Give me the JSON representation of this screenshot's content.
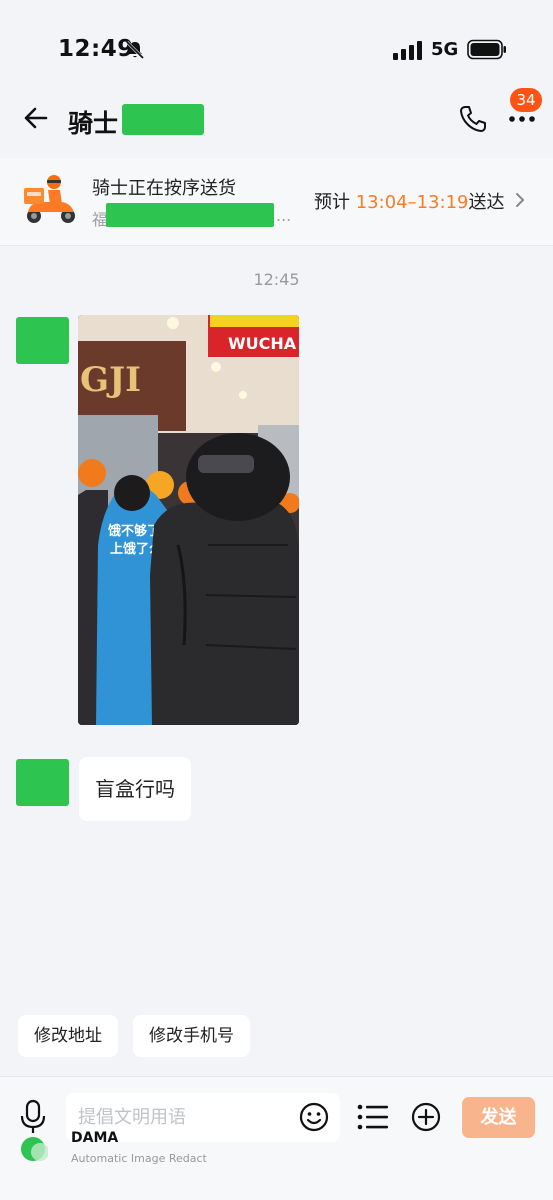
{
  "status_bar": {
    "time": "12:49",
    "network": "5G"
  },
  "header": {
    "title": "骑士",
    "unread_badge": "34"
  },
  "rider_card": {
    "status": "骑士正在按序送货",
    "address_prefix": "福",
    "address_ellipsis": "...",
    "eta_prefix": "预计",
    "eta_time": "13:04–13:19",
    "eta_suffix": "送达"
  },
  "chat": {
    "timestamp": "12:45",
    "photo_sign_text": "WUCHA",
    "photo_jacket_text_1": "饿不够了",
    "photo_jacket_text_2": "上饿了么",
    "message": "盲盒行吗"
  },
  "quick_actions": [
    "修改地址",
    "修改手机号"
  ],
  "input": {
    "placeholder": "提倡文明用语",
    "send_label": "发送"
  },
  "watermark": {
    "title": "DAMA",
    "subtitle": "Automatic Image Redact"
  },
  "colors": {
    "accent_orange": "#ff7a22",
    "redact_green": "#2dc54f",
    "badge": "#ff5316"
  }
}
